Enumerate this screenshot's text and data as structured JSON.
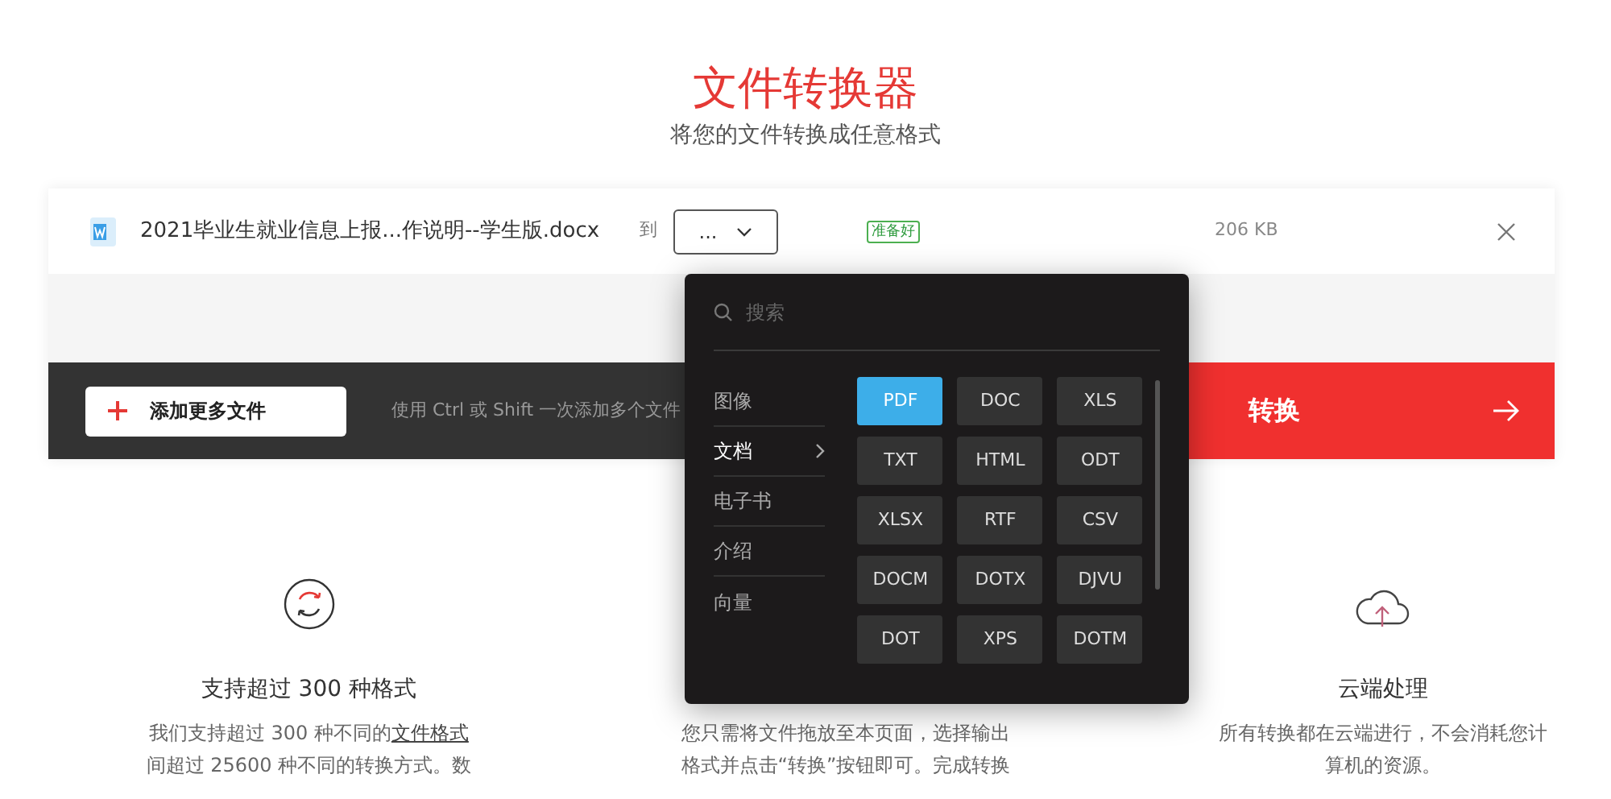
{
  "header": {
    "title": "文件转换器",
    "subtitle": "将您的文件转换成任意格式"
  },
  "file": {
    "name": "2021毕业生就业信息上报...作说明--学生版.docx",
    "to_label": "到",
    "format_value": "...",
    "status": "准备好",
    "size": "206 KB"
  },
  "toolbar": {
    "add_button": "添加更多文件",
    "hint": "使用 Ctrl 或 Shift 一次添加多个文件",
    "convert_button": "转换"
  },
  "dropdown": {
    "search_placeholder": "搜索",
    "categories": [
      {
        "label": "图像",
        "selected": false
      },
      {
        "label": "文档",
        "selected": true
      },
      {
        "label": "电子书",
        "selected": false
      },
      {
        "label": "介绍",
        "selected": false
      },
      {
        "label": "向量",
        "selected": false
      }
    ],
    "formats": [
      {
        "label": "PDF",
        "selected": true
      },
      {
        "label": "DOC",
        "selected": false
      },
      {
        "label": "XLS",
        "selected": false
      },
      {
        "label": "TXT",
        "selected": false
      },
      {
        "label": "HTML",
        "selected": false
      },
      {
        "label": "ODT",
        "selected": false
      },
      {
        "label": "XLSX",
        "selected": false
      },
      {
        "label": "RTF",
        "selected": false
      },
      {
        "label": "CSV",
        "selected": false
      },
      {
        "label": "DOCM",
        "selected": false
      },
      {
        "label": "DOTX",
        "selected": false
      },
      {
        "label": "DJVU",
        "selected": false
      },
      {
        "label": "DOT",
        "selected": false
      },
      {
        "label": "XPS",
        "selected": false
      },
      {
        "label": "DOTM",
        "selected": false
      }
    ]
  },
  "features": [
    {
      "kind": "formats",
      "title": "支持超过 300 种格式",
      "lines": [
        {
          "text": "我们支持超过 300 种不同的",
          "link": "文件格式"
        },
        {
          "text": "间超过 25600 种不同的转换方式。数"
        }
      ]
    },
    {
      "kind": "hidden",
      "lines": [
        {
          "text": "您只需将文件拖放至本页面，选择输出"
        },
        {
          "text": "格式并点击“转换”按钮即可。完成转换"
        }
      ]
    },
    {
      "kind": "cloud",
      "title": "云端处理",
      "lines": [
        {
          "text": "所有转换都在云端进行，不会消耗您计"
        },
        {
          "text": "算机的资源。"
        }
      ]
    }
  ]
}
